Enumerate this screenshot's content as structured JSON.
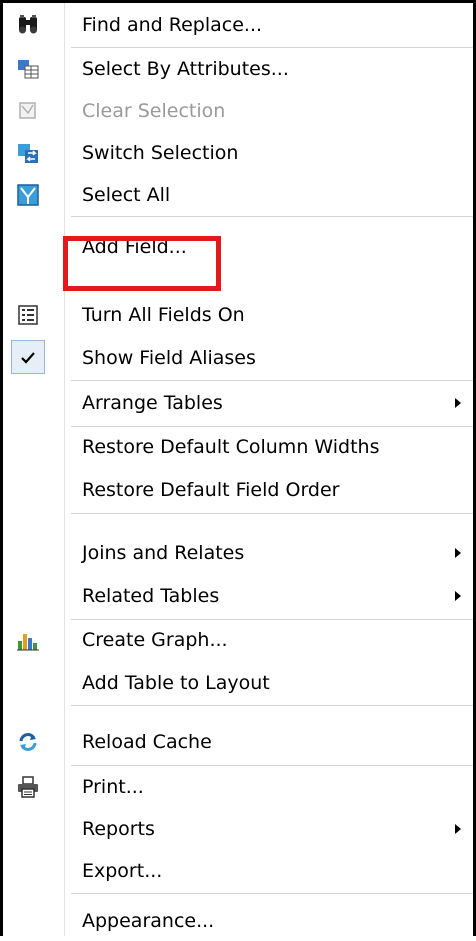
{
  "menu": {
    "items": [
      {
        "label": "Find and Replace...",
        "icon": "binoculars-icon",
        "enabled": true
      },
      {
        "label": "Select By Attributes...",
        "icon": "select-by-attributes-icon",
        "enabled": true
      },
      {
        "label": "Clear Selection",
        "icon": "clear-selection-icon",
        "enabled": false
      },
      {
        "label": "Switch Selection",
        "icon": "switch-selection-icon",
        "enabled": true
      },
      {
        "label": "Select All",
        "icon": "select-all-icon",
        "enabled": true
      },
      {
        "label": "Add Field...",
        "icon": "",
        "enabled": true
      },
      {
        "label": "Turn All Fields On",
        "icon": "field-list-icon",
        "enabled": true
      },
      {
        "label": "Show Field Aliases",
        "icon": "checkmark-icon",
        "enabled": true,
        "checked": true
      },
      {
        "label": "Arrange Tables",
        "icon": "",
        "enabled": true,
        "submenu": true
      },
      {
        "label": "Restore Default Column Widths",
        "icon": "",
        "enabled": true
      },
      {
        "label": "Restore Default Field Order",
        "icon": "",
        "enabled": true
      },
      {
        "label": "Joins and Relates",
        "icon": "",
        "enabled": true,
        "submenu": true
      },
      {
        "label": "Related Tables",
        "icon": "",
        "enabled": true,
        "submenu": true
      },
      {
        "label": "Create Graph...",
        "icon": "bar-graph-icon",
        "enabled": true
      },
      {
        "label": "Add Table to Layout",
        "icon": "",
        "enabled": true
      },
      {
        "label": "Reload Cache",
        "icon": "reload-icon",
        "enabled": true
      },
      {
        "label": "Print...",
        "icon": "printer-icon",
        "enabled": true
      },
      {
        "label": "Reports",
        "icon": "",
        "enabled": true,
        "submenu": true
      },
      {
        "label": "Export...",
        "icon": "",
        "enabled": true
      },
      {
        "label": "Appearance...",
        "icon": "",
        "enabled": true
      }
    ]
  },
  "colors": {
    "highlight": "#e21a1a",
    "disabled_text": "#9a9a9a",
    "separator": "#d4d4d4",
    "check_frame": "#99b7da"
  }
}
